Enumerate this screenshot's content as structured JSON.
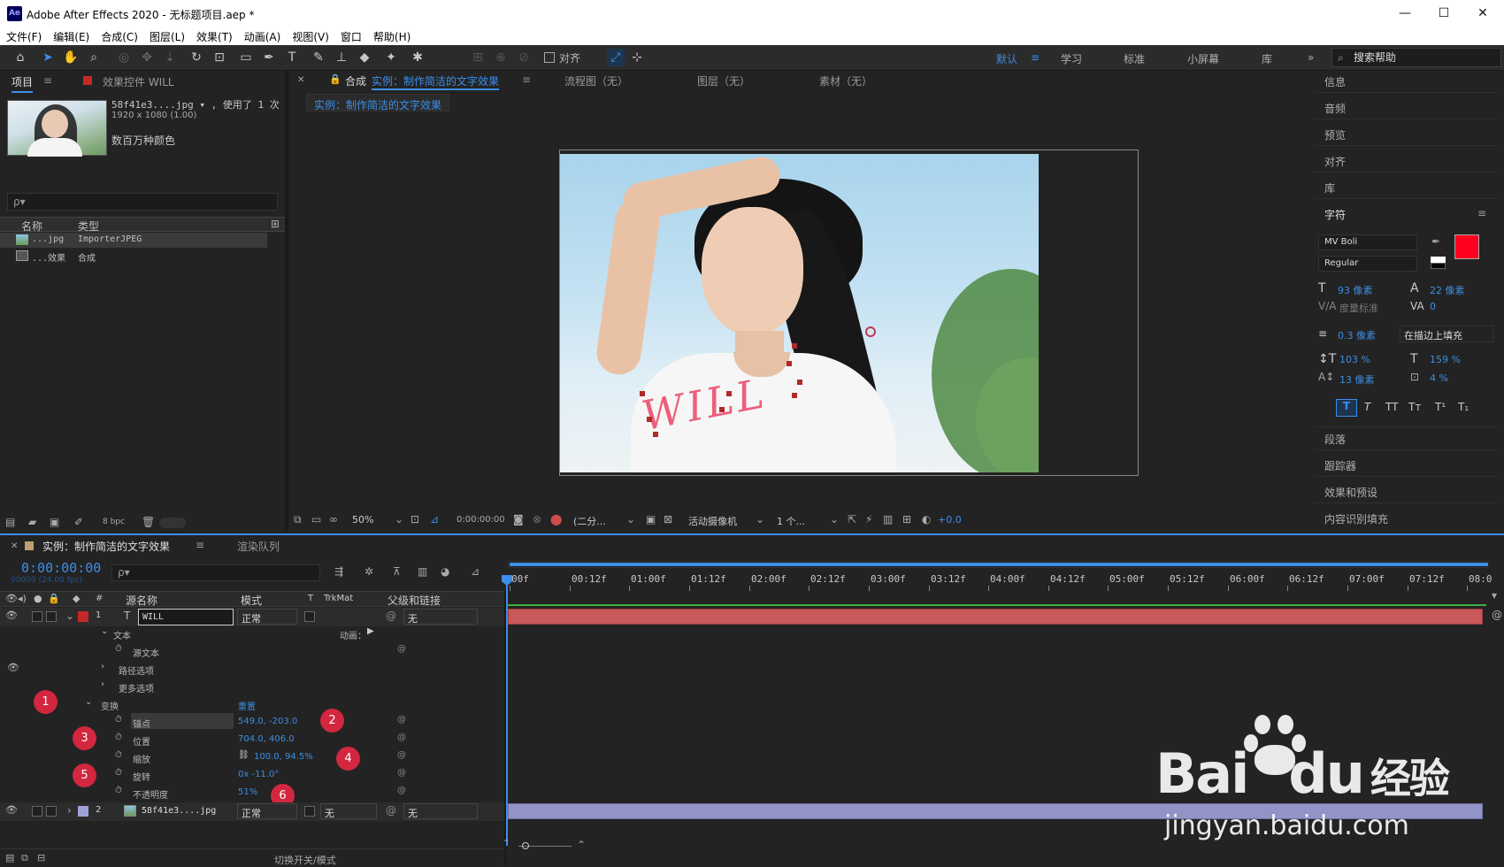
{
  "window": {
    "title": "Adobe After Effects 2020 - 无标题项目.aep *",
    "icon_text": "Ae",
    "minimize": "—",
    "maximize": "☐",
    "close": "✕"
  },
  "menu": [
    "文件(F)",
    "编辑(E)",
    "合成(C)",
    "图层(L)",
    "效果(T)",
    "动画(A)",
    "视图(V)",
    "窗口",
    "帮助(H)"
  ],
  "toolbar": {
    "align_label": "对齐",
    "workspaces": [
      "默认",
      "学习",
      "标准",
      "小屏幕",
      "库"
    ],
    "search_help": "搜索帮助",
    "more": "»"
  },
  "project": {
    "tab_project": "项目",
    "tab_effects": "效果控件 WILL",
    "file_name": "58f41e3....jpg ▾ , 使用了 1 次",
    "file_dims": "1920 x 1080 (1.00)",
    "file_colors": "数百万种颜色",
    "search_placeholder": "ρ▾",
    "col_name": "名称",
    "col_type": "类型",
    "items": [
      {
        "name": "...jpg",
        "type": "ImporterJPEG"
      },
      {
        "name": "...效果",
        "type": "合成"
      }
    ],
    "bpc": "8 bpc"
  },
  "viewer": {
    "comp_tab_prefix": "合成",
    "comp_tab_name": "实例：制作简洁的文字效果",
    "tab_flow": "流程图（无）",
    "tab_layer": "图层（无）",
    "tab_footage": "素材（无）",
    "breadcrumb": "实例：制作简洁的文字效果",
    "text_layer": "WILL",
    "zoom": "50%",
    "timecode": "0:00:00:00",
    "resolution": "(二分...",
    "camera": "活动摄像机",
    "views": "1 个...",
    "exposure": "+0.0"
  },
  "right_panel": {
    "items_top": [
      "信息",
      "音频",
      "预览",
      "对齐",
      "库"
    ],
    "character_title": "字符",
    "font": "MV Boli",
    "style": "Regular",
    "font_size": "93 像素",
    "leading": "22 像素",
    "kerning": "度量标准",
    "tracking": "0",
    "stroke": "0.3 像素",
    "stroke_mode": "在描边上填充",
    "vscale": "103 %",
    "hscale": "159 %",
    "baseline": "13 像素",
    "tsume": "4 %",
    "style_buttons": [
      "T",
      "T",
      "TT",
      "Tт",
      "T¹",
      "T₁"
    ],
    "items_bottom": [
      "段落",
      "跟踪器",
      "效果和预设",
      "内容识别填充"
    ],
    "fill_color": "#ff0020"
  },
  "timeline": {
    "tab_comp": "实例：制作简洁的文字效果",
    "tab_render": "渲染队列",
    "timecode": "0:00:00:00",
    "timecode_sub": "00000 (24.00 fps)",
    "col_name": "源名称",
    "col_mode": "模式",
    "col_t": "T",
    "col_trkmat": "TrkMat",
    "col_parent": "父级和链接",
    "ruler": [
      "00f",
      "00:12f",
      "01:00f",
      "01:12f",
      "02:00f",
      "02:12f",
      "03:00f",
      "03:12f",
      "04:00f",
      "04:12f",
      "05:00f",
      "05:12f",
      "06:00f",
      "06:12f",
      "07:00f",
      "07:12f",
      "08:0"
    ],
    "layer1": {
      "num": "1",
      "type": "T",
      "name": "WILL",
      "mode": "正常",
      "parent": "无"
    },
    "layer2": {
      "num": "2",
      "name": "58f41e3....jpg",
      "mode": "正常",
      "trkmat": "无",
      "parent": "无"
    },
    "props": {
      "text": "文本",
      "animate": "动画：",
      "source_text": "源文本",
      "path_options": "路径选项",
      "more_options": "更多选项",
      "transform": "变换",
      "reset": "重置",
      "anchor": "锚点",
      "anchor_val": "549.0, -203.0",
      "position": "位置",
      "position_val": "704.0, 406.0",
      "scale": "缩放",
      "scale_val": "100.0, 94.5%",
      "rotation": "旋转",
      "rotation_val": "0x -11.0°",
      "opacity": "不透明度",
      "opacity_val": "51%"
    },
    "badges": [
      "1",
      "2",
      "3",
      "4",
      "5",
      "6"
    ],
    "footer": "切换开关/模式"
  },
  "watermark": {
    "brand": "Bai",
    "brand2": "du",
    "cn": "经验",
    "url": "jingyan.baidu.com"
  }
}
